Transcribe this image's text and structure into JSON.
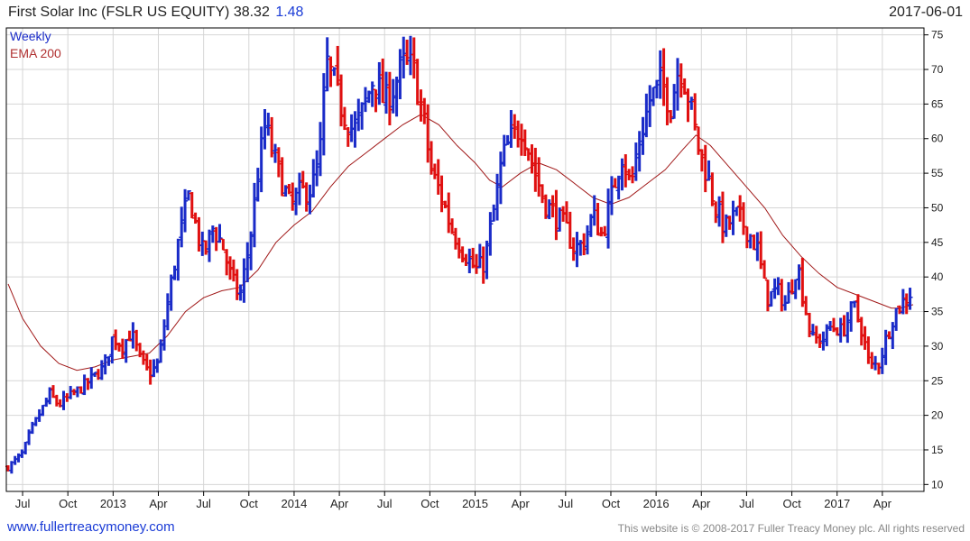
{
  "header": {
    "title": "First Solar Inc (FSLR US EQUITY) 38.32",
    "change": "1.48",
    "date": "2017-06-01"
  },
  "footer": {
    "site": "www.fullertreacymoney.com",
    "copyright": "This website is © 2008-2017 Fuller Treacy Money plc. All rights reserved"
  },
  "colors": {
    "up": "#1a2bc8",
    "down": "#e01010",
    "ema": "#a01818",
    "grid": "#d6d6d6",
    "axis": "#000000"
  },
  "chart_data": {
    "type": "ohlc",
    "legend": [
      "Weekly",
      "EMA 200"
    ],
    "legend_position": "top-left",
    "y_axis_side": "right",
    "ylim": [
      9,
      76
    ],
    "yticks": [
      10,
      15,
      20,
      25,
      30,
      35,
      40,
      45,
      50,
      55,
      60,
      65,
      70,
      75
    ],
    "xlim": [
      2012.42,
      2017.46
    ],
    "xticks": [
      {
        "label": "Jul",
        "t": 2012.5
      },
      {
        "label": "Oct",
        "t": 2012.75
      },
      {
        "label": "2013",
        "t": 2013.0
      },
      {
        "label": "Apr",
        "t": 2013.25
      },
      {
        "label": "Jul",
        "t": 2013.5
      },
      {
        "label": "Oct",
        "t": 2013.75
      },
      {
        "label": "2014",
        "t": 2014.0
      },
      {
        "label": "Apr",
        "t": 2014.25
      },
      {
        "label": "Jul",
        "t": 2014.5
      },
      {
        "label": "Oct",
        "t": 2014.75
      },
      {
        "label": "2015",
        "t": 2015.0
      },
      {
        "label": "Apr",
        "t": 2015.25
      },
      {
        "label": "Jul",
        "t": 2015.5
      },
      {
        "label": "Oct",
        "t": 2015.75
      },
      {
        "label": "2016",
        "t": 2016.0
      },
      {
        "label": "Apr",
        "t": 2016.25
      },
      {
        "label": "Jul",
        "t": 2016.5
      },
      {
        "label": "Oct",
        "t": 2016.75
      },
      {
        "label": "2017",
        "t": 2017.0
      },
      {
        "label": "Apr",
        "t": 2017.25
      }
    ],
    "close_path": [
      [
        2012.42,
        12.5
      ],
      [
        2012.5,
        14.5
      ],
      [
        2012.55,
        18
      ],
      [
        2012.6,
        20.5
      ],
      [
        2012.65,
        23
      ],
      [
        2012.7,
        21.5
      ],
      [
        2012.75,
        22.5
      ],
      [
        2012.85,
        24.5
      ],
      [
        2012.95,
        27
      ],
      [
        2013.0,
        31.5
      ],
      [
        2013.05,
        30
      ],
      [
        2013.1,
        32
      ],
      [
        2013.15,
        28
      ],
      [
        2013.2,
        26
      ],
      [
        2013.25,
        27.5
      ],
      [
        2013.3,
        36
      ],
      [
        2013.36,
        45
      ],
      [
        2013.42,
        52
      ],
      [
        2013.46,
        47
      ],
      [
        2013.5,
        43
      ],
      [
        2013.55,
        47
      ],
      [
        2013.6,
        45
      ],
      [
        2013.65,
        40
      ],
      [
        2013.7,
        37
      ],
      [
        2013.76,
        46
      ],
      [
        2013.8,
        55
      ],
      [
        2013.84,
        62
      ],
      [
        2013.88,
        58
      ],
      [
        2013.93,
        54
      ],
      [
        2013.98,
        50
      ],
      [
        2014.03,
        52
      ],
      [
        2014.1,
        53
      ],
      [
        2014.14,
        57
      ],
      [
        2014.18,
        71
      ],
      [
        2014.22,
        68
      ],
      [
        2014.27,
        64
      ],
      [
        2014.33,
        61
      ],
      [
        2014.38,
        64
      ],
      [
        2014.44,
        69
      ],
      [
        2014.5,
        65
      ],
      [
        2014.56,
        68
      ],
      [
        2014.61,
        71
      ],
      [
        2014.66,
        70
      ],
      [
        2014.72,
        62
      ],
      [
        2014.76,
        55
      ],
      [
        2014.81,
        52
      ],
      [
        2014.87,
        47
      ],
      [
        2014.93,
        44
      ],
      [
        2015.0,
        41
      ],
      [
        2015.05,
        42
      ],
      [
        2015.1,
        49
      ],
      [
        2015.15,
        57
      ],
      [
        2015.2,
        60
      ],
      [
        2015.26,
        62
      ],
      [
        2015.32,
        56
      ],
      [
        2015.38,
        51
      ],
      [
        2015.44,
        49
      ],
      [
        2015.5,
        47
      ],
      [
        2015.55,
        44
      ],
      [
        2015.6,
        45
      ],
      [
        2015.65,
        49
      ],
      [
        2015.7,
        46
      ],
      [
        2015.75,
        51
      ],
      [
        2015.81,
        58
      ],
      [
        2015.86,
        53
      ],
      [
        2015.91,
        60
      ],
      [
        2015.97,
        66
      ],
      [
        2016.03,
        68
      ],
      [
        2016.08,
        65
      ],
      [
        2016.13,
        71
      ],
      [
        2016.18,
        66
      ],
      [
        2016.23,
        59
      ],
      [
        2016.28,
        55
      ],
      [
        2016.33,
        50
      ],
      [
        2016.38,
        47
      ],
      [
        2016.44,
        49
      ],
      [
        2016.5,
        47
      ],
      [
        2016.56,
        44
      ],
      [
        2016.61,
        37
      ],
      [
        2016.67,
        38
      ],
      [
        2016.72,
        36
      ],
      [
        2016.78,
        42
      ],
      [
        2016.82,
        36
      ],
      [
        2016.86,
        31
      ],
      [
        2016.92,
        31
      ],
      [
        2016.97,
        33
      ],
      [
        2017.03,
        32
      ],
      [
        2017.09,
        36
      ],
      [
        2017.14,
        32
      ],
      [
        2017.18,
        27
      ],
      [
        2017.23,
        27.5
      ],
      [
        2017.27,
        31
      ],
      [
        2017.32,
        35
      ],
      [
        2017.37,
        36.5
      ],
      [
        2017.42,
        38.3
      ]
    ],
    "ema_200": [
      [
        2012.42,
        39
      ],
      [
        2012.5,
        34
      ],
      [
        2012.6,
        30
      ],
      [
        2012.7,
        27.5
      ],
      [
        2012.8,
        26.5
      ],
      [
        2012.9,
        27
      ],
      [
        2013.0,
        28
      ],
      [
        2013.1,
        28.5
      ],
      [
        2013.2,
        29
      ],
      [
        2013.3,
        31.5
      ],
      [
        2013.4,
        35
      ],
      [
        2013.5,
        37
      ],
      [
        2013.6,
        38
      ],
      [
        2013.7,
        38.5
      ],
      [
        2013.8,
        41
      ],
      [
        2013.9,
        45
      ],
      [
        2014.0,
        47.5
      ],
      [
        2014.1,
        49.5
      ],
      [
        2014.2,
        53
      ],
      [
        2014.3,
        56
      ],
      [
        2014.4,
        58
      ],
      [
        2014.5,
        60
      ],
      [
        2014.6,
        62
      ],
      [
        2014.7,
        63.5
      ],
      [
        2014.8,
        62
      ],
      [
        2014.9,
        59
      ],
      [
        2015.0,
        56.5
      ],
      [
        2015.08,
        54
      ],
      [
        2015.15,
        53
      ],
      [
        2015.25,
        55
      ],
      [
        2015.35,
        56.5
      ],
      [
        2015.45,
        55.5
      ],
      [
        2015.55,
        53.5
      ],
      [
        2015.65,
        51.5
      ],
      [
        2015.75,
        50.5
      ],
      [
        2015.85,
        51.5
      ],
      [
        2015.95,
        53.5
      ],
      [
        2016.05,
        55.5
      ],
      [
        2016.15,
        58.5
      ],
      [
        2016.22,
        60.5
      ],
      [
        2016.3,
        59
      ],
      [
        2016.4,
        56
      ],
      [
        2016.5,
        53
      ],
      [
        2016.6,
        50
      ],
      [
        2016.7,
        46
      ],
      [
        2016.8,
        43
      ],
      [
        2016.9,
        40.5
      ],
      [
        2017.0,
        38.5
      ],
      [
        2017.1,
        37.5
      ],
      [
        2017.2,
        36.5
      ],
      [
        2017.3,
        35.5
      ],
      [
        2017.35,
        35.5
      ],
      [
        2017.42,
        36
      ]
    ]
  }
}
